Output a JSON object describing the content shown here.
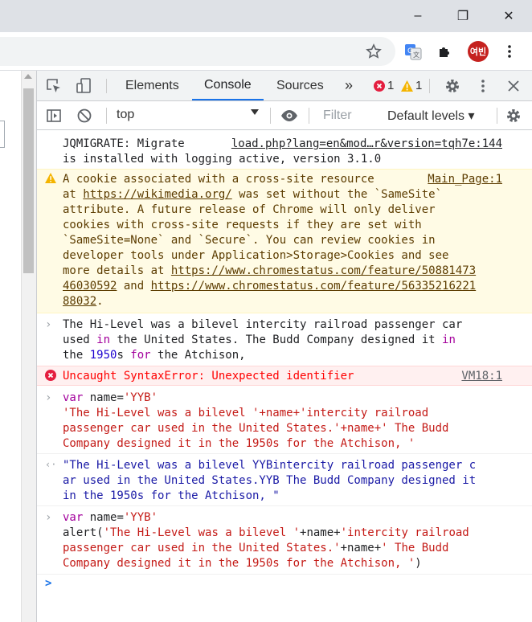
{
  "window": {
    "minimize_glyph": "–",
    "restore_glyph": "❐",
    "close_glyph": "✕"
  },
  "toolbar": {
    "profile_initials": "여빈"
  },
  "devtools": {
    "tabs": [
      "Elements",
      "Console",
      "Sources"
    ],
    "more_tabs_glyph": "»",
    "error_count": "1",
    "warning_count": "1",
    "context": "top",
    "filter_placeholder": "Filter",
    "levels": "Default levels ▾"
  },
  "console": {
    "log1": {
      "lines": [
        "JQMIGRATE: Migrate",
        "is installed with logging active, version 3.1.0"
      ],
      "source": "load.php?lang=en&mod…r&version=tqh7e:144"
    },
    "warning": {
      "source": "Main_Page:1",
      "l1": "A cookie associated with a cross-site resource",
      "l2a": "at ",
      "l2link": "https://wikimedia.org/",
      "l2b": " was set without the `SameSite`",
      "l3": "attribute. A future release of Chrome will only deliver",
      "l4": "cookies with cross-site requests if they are set with",
      "l5": "`SameSite=None` and `Secure`. You can review cookies in",
      "l6": "developer tools under Application>Storage>Cookies and see",
      "l7a": "more details at ",
      "l7link": "https://www.chromestatus.com/feature/50881473",
      "l8link": "46030592",
      "l8b": " and ",
      "l8link2": "https://www.chromestatus.com/feature/56335216221",
      "l9link": "88032",
      "l9b": "."
    },
    "input1": {
      "l1": "The Hi-Level was a bilevel intercity railroad passenger car",
      "l2a": "used ",
      "l2kw": "in",
      "l2b": " the United States. The Budd Company designed it ",
      "l2kw2": "in",
      "l3a": "the ",
      "l3num": "1950",
      "l3b": "s ",
      "l3kw": "for",
      "l3c": " the Atchison,"
    },
    "error": {
      "text": "Uncaught SyntaxError: Unexpected identifier",
      "source": "VM18:1"
    },
    "input2": {
      "l1kw": "var",
      "l1a": " name=",
      "l1str": "'YYB'",
      "l2": "'The Hi-Level was a bilevel '+name+'intercity railroad",
      "l3": "passenger car used in the United States.'+name+' The Budd",
      "l4": "Company designed it in the 1950s for the Atchison, '"
    },
    "result": {
      "l1": "\"The Hi-Level was a bilevel YYBintercity railroad passenger c",
      "l2": "ar used in the United States.YYB The Budd Company designed it",
      "l3": "in the 1950s for the Atchison, \""
    },
    "input3": {
      "l1kw": "var",
      "l1a": " name=",
      "l1str": "'YYB'",
      "l2a": "alert(",
      "l2str": "'The Hi-Level was a bilevel '",
      "l2b": "+name+",
      "l2str2": "'intercity railroad",
      "l3str": "passenger car used in the United States.'",
      "l3b": "+name+",
      "l3str2": "' The Budd",
      "l4str": "Company designed it in the 1950s for the Atchison, '",
      "l4b": ")"
    },
    "prompt_glyph": ">"
  }
}
